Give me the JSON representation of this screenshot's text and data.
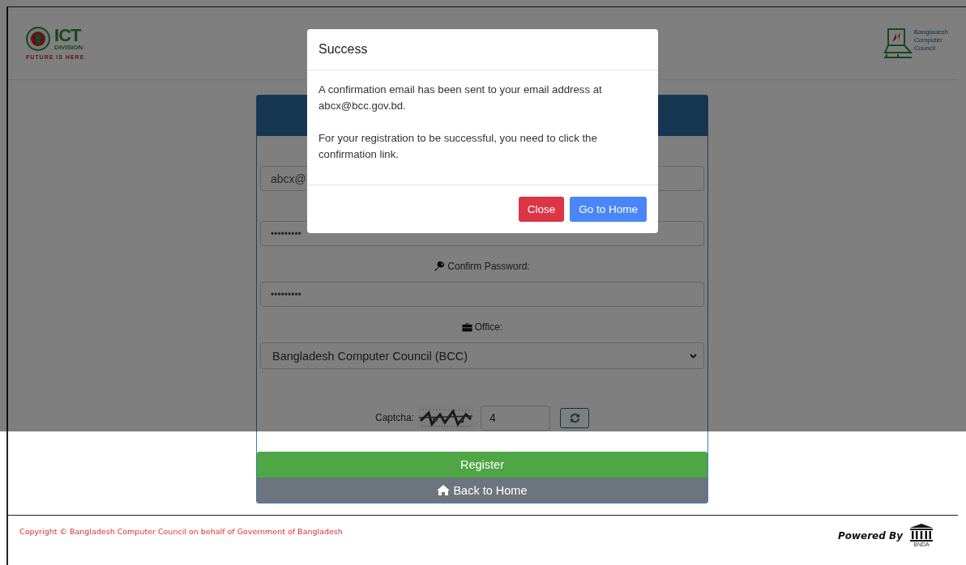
{
  "header": {
    "ict_logo": {
      "title": "ICT",
      "subtitle": "DIVISION",
      "tagline": "FUTURE IS HERE"
    },
    "bcc_logo": {
      "lines": [
        "Bangladesh",
        "Computer",
        "Council"
      ]
    }
  },
  "form": {
    "email": {
      "value": "abcx@"
    },
    "password": {
      "value": "•••••••••"
    },
    "confirm_password": {
      "label": "Confirm Password:",
      "value": "•••••••••"
    },
    "office": {
      "label": "Office:",
      "value": "Bangladesh Computer Council (BCC)"
    },
    "captcha": {
      "label": "Captcha:",
      "answer": "4"
    },
    "buttons": [
      {
        "label": "Register",
        "kind": "register"
      },
      {
        "label": "Back to Home",
        "kind": "home"
      }
    ]
  },
  "modal": {
    "title": "Success",
    "paragraphs": [
      "A confirmation email has been sent to your email address at abcx@bcc.gov.bd.",
      "For your registration to be successful, you need to click the confirmation link."
    ],
    "buttons": [
      {
        "label": "Close",
        "kind": "danger"
      },
      {
        "label": "Go to Home",
        "kind": "primary"
      }
    ]
  },
  "footer": {
    "copyright": "Copyright © Bangladesh Computer Council on behalf of Government of Bangladesh",
    "powered_by": "Powered By",
    "brand": "BNDA"
  }
}
